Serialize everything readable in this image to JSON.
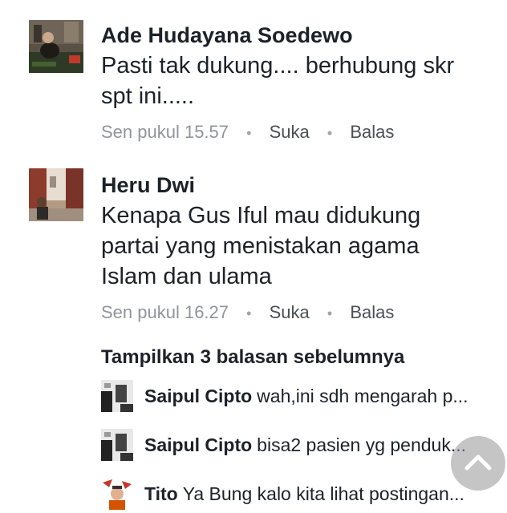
{
  "comments": [
    {
      "author": "Ade Hudayana Soedewo",
      "lines": [
        "Pasti tak dukung.... berhubung skr",
        "spt ini....."
      ],
      "time": "Sen pukul 15.57",
      "like": "Suka",
      "reply": "Balas"
    },
    {
      "author": "Heru Dwi",
      "lines": [
        "Kenapa Gus Iful mau didukung",
        "partai yang menistakan agama",
        "Islam dan ulama"
      ],
      "time": "Sen pukul 16.27",
      "like": "Suka",
      "reply": "Balas"
    }
  ],
  "replies_toggle": "Tampilkan 3 balasan sebelumnya",
  "replies": [
    {
      "author": "Saipul Cipto",
      "text": "wah,ini sdh mengarah p..."
    },
    {
      "author": "Saipul Cipto",
      "text": "bisa2 pasien yg penduk..."
    },
    {
      "author": "Tito",
      "text": "Ya Bung kalo kita lihat postingan..."
    }
  ],
  "meta_separator": "•",
  "scroll_top_icon": "chevron-up-icon"
}
